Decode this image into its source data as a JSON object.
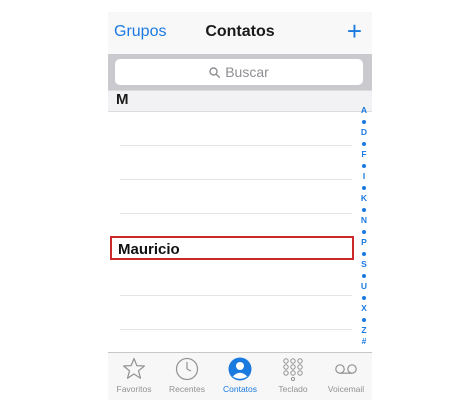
{
  "navbar": {
    "left_label": "Grupos",
    "title": "Contatos",
    "add_label": "+"
  },
  "search": {
    "placeholder": "Buscar"
  },
  "list": {
    "section": "M",
    "highlighted_contact": "Mauricio"
  },
  "index": [
    "A",
    "•",
    "D",
    "•",
    "F",
    "•",
    "I",
    "•",
    "K",
    "•",
    "N",
    "•",
    "P",
    "•",
    "S",
    "•",
    "U",
    "•",
    "X",
    "•",
    "Z",
    "#"
  ],
  "tabs": [
    {
      "label": "Favoritos",
      "icon": "star-icon",
      "active": false
    },
    {
      "label": "Recentes",
      "icon": "clock-icon",
      "active": false
    },
    {
      "label": "Contatos",
      "icon": "person-icon",
      "active": true
    },
    {
      "label": "Teclado",
      "icon": "keypad-icon",
      "active": false
    },
    {
      "label": "Voicemail",
      "icon": "voicemail-icon",
      "active": false
    }
  ],
  "colors": {
    "accent": "#1a7ae0",
    "highlight_border": "#cc2a2a",
    "search_background": "#c9c9ce"
  }
}
